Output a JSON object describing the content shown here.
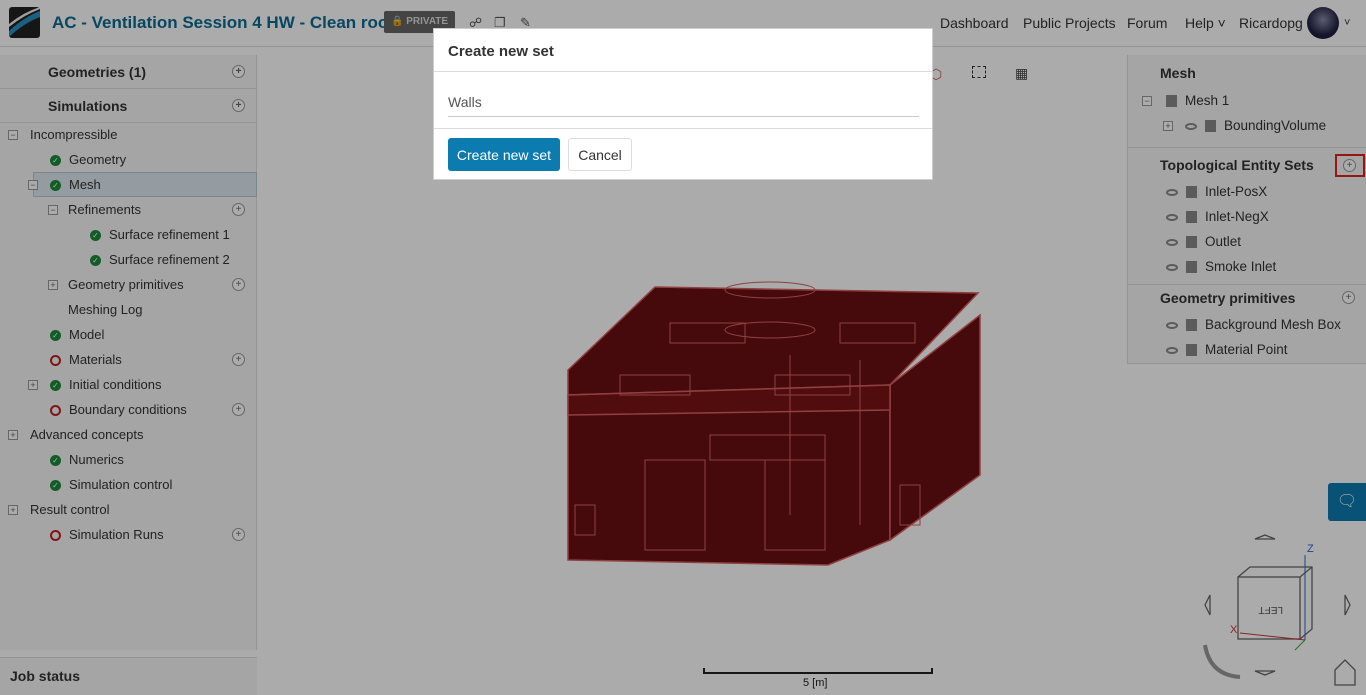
{
  "header": {
    "title": "AC - Ventilation Session 4 HW - Clean room",
    "privacy_badge": "PRIVATE",
    "nav": [
      "Dashboard",
      "Public Projects",
      "Forum",
      "Help"
    ],
    "user": "Ricardopg"
  },
  "left_panel": {
    "geometries": "Geometries (1)",
    "simulations": "Simulations",
    "tree": [
      {
        "label": "Incompressible",
        "status": "none"
      },
      {
        "label": "Geometry",
        "status": "ok"
      },
      {
        "label": "Mesh",
        "status": "ok",
        "selected": true
      },
      {
        "label": "Refinements",
        "status": "none"
      },
      {
        "label": "Surface refinement 1",
        "status": "ok"
      },
      {
        "label": "Surface refinement 2",
        "status": "ok"
      },
      {
        "label": "Geometry primitives",
        "status": "none"
      },
      {
        "label": "Meshing Log",
        "status": "none"
      },
      {
        "label": "Model",
        "status": "ok"
      },
      {
        "label": "Materials",
        "status": "error"
      },
      {
        "label": "Initial conditions",
        "status": "ok"
      },
      {
        "label": "Boundary conditions",
        "status": "error"
      },
      {
        "label": "Advanced concepts",
        "status": "none"
      },
      {
        "label": "Numerics",
        "status": "ok"
      },
      {
        "label": "Simulation control",
        "status": "ok"
      },
      {
        "label": "Result control",
        "status": "none"
      },
      {
        "label": "Simulation Runs",
        "status": "error"
      }
    ],
    "job_status": "Job status"
  },
  "right_panel": {
    "mesh_title": "Mesh",
    "mesh_item": "Mesh 1",
    "bounding": "BoundingVolume",
    "tes_title": "Topological Entity Sets",
    "tes_items": [
      "Inlet-PosX",
      "Inlet-NegX",
      "Outlet",
      "Smoke Inlet"
    ],
    "gp_title": "Geometry primitives",
    "gp_items": [
      "Background Mesh Box",
      "Material Point"
    ]
  },
  "viewer": {
    "scale_label": "5 [m]",
    "cube_face": "LEFT",
    "axis_z": "Z",
    "axis_x": "X"
  },
  "modal": {
    "title": "Create new set",
    "input_value": "Walls",
    "create_label": "Create new set",
    "cancel_label": "Cancel"
  },
  "colors": {
    "accent": "#0b7bb0",
    "mesh": "#6b0f12",
    "highlight": "#e02020"
  }
}
